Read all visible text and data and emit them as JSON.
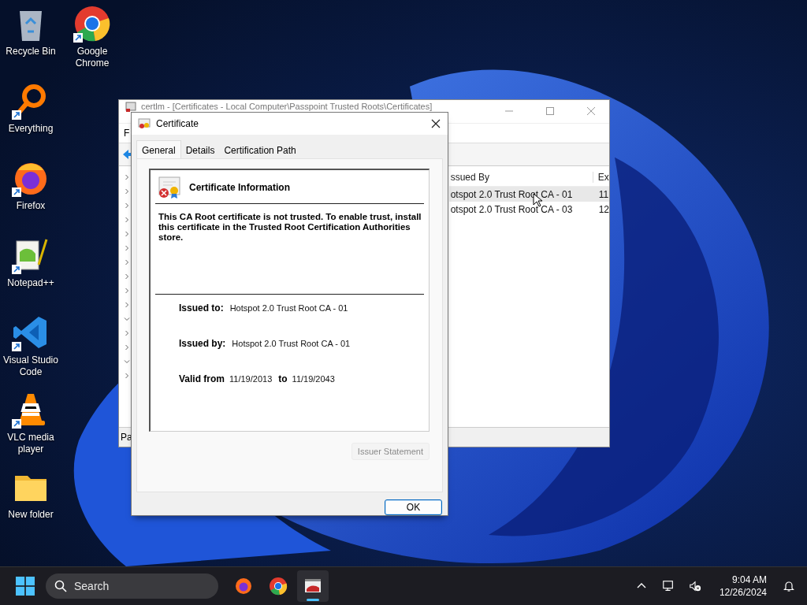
{
  "desktop_icons": [
    {
      "kind": "recycle-bin",
      "label": "Recycle Bin",
      "shortcut": false
    },
    {
      "kind": "magnifier",
      "label": "Everything",
      "shortcut": true
    },
    {
      "kind": "firefox",
      "label": "Firefox",
      "shortcut": true
    },
    {
      "kind": "notepad",
      "label": "Notepad++",
      "shortcut": true
    },
    {
      "kind": "vscode",
      "label": "Visual Studio Code",
      "shortcut": true
    },
    {
      "kind": "vlc",
      "label": "VLC media player",
      "shortcut": true
    },
    {
      "kind": "folder",
      "label": "New folder",
      "shortcut": false
    },
    {
      "kind": "chrome",
      "label": "Google Chrome",
      "shortcut": true
    }
  ],
  "background_window": {
    "title": "certlm - [Certificates - Local Computer\\Passpoint Trusted Roots\\Certificates]",
    "menu_fragment": "F",
    "tree_toggles": [
      {
        "expanded": false
      },
      {
        "expanded": false
      },
      {
        "expanded": false
      },
      {
        "expanded": false
      },
      {
        "expanded": false
      },
      {
        "expanded": false
      },
      {
        "expanded": false
      },
      {
        "expanded": false
      },
      {
        "expanded": false
      },
      {
        "expanded": false
      },
      {
        "expanded": true
      },
      {
        "expanded": false
      },
      {
        "expanded": false
      },
      {
        "expanded": true
      },
      {
        "expanded": false
      }
    ],
    "columns": [
      "ssued By",
      "Ex"
    ],
    "rows": [
      {
        "issued_by": "otspot 2.0 Trust Root CA - 01",
        "column_2": "11",
        "highlighted": true
      },
      {
        "issued_by": "otspot 2.0 Trust Root CA - 03",
        "column_2": "12",
        "highlighted": false
      }
    ],
    "status_fragment": "Pa"
  },
  "dialog": {
    "title": "Certificate",
    "tabs": [
      {
        "label": "General",
        "selected": true
      },
      {
        "label": "Details",
        "selected": false
      },
      {
        "label": "Certification Path",
        "selected": false
      }
    ],
    "heading": "Certificate Information",
    "message": "This CA Root certificate is not trusted. To enable trust, install this certificate in the Trusted Root Certification Authorities store.",
    "issued_to": {
      "label": "Issued to:",
      "value": "Hotspot 2.0 Trust Root CA - 01"
    },
    "issued_by": {
      "label": "Issued by:",
      "value": "Hotspot 2.0 Trust Root CA - 01"
    },
    "validity": {
      "label": "Valid from",
      "from": "11/19/2013",
      "separator": "to",
      "to": "11/19/2043"
    },
    "issuer_statement": {
      "label": "Issuer Statement",
      "disabled": true
    },
    "ok_button": {
      "label": "OK",
      "default": true
    }
  },
  "taskbar": {
    "search_placeholder": "Search",
    "apps": [
      {
        "kind": "firefox",
        "active": false
      },
      {
        "kind": "chrome",
        "active": false
      },
      {
        "kind": "certlm",
        "active": true
      }
    ],
    "time": "9:04 AM",
    "date": "12/26/2024"
  }
}
